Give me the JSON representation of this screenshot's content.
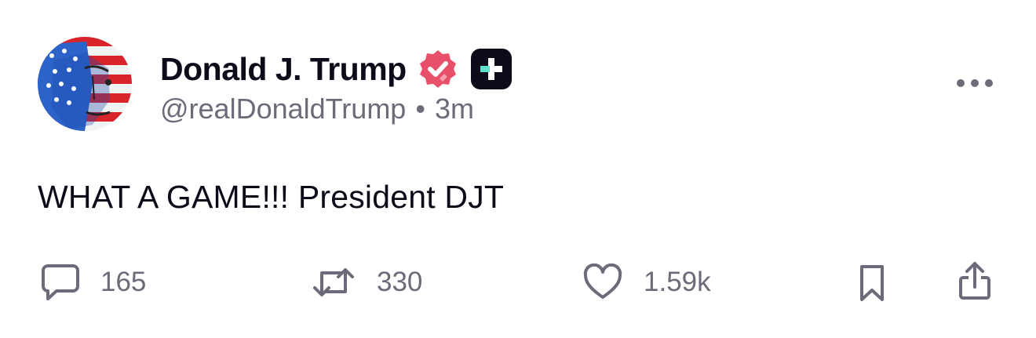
{
  "author": {
    "display_name": "Donald J. Trump",
    "handle": "@realDonaldTrump",
    "separator": "•",
    "timestamp": "3m",
    "verified_icon": "verified-badge-icon",
    "plus_icon": "plus-badge-icon",
    "avatar_icon": "avatar"
  },
  "post": {
    "text": "WHAT A GAME!!! President DJT"
  },
  "actions": {
    "replies": "165",
    "reposts": "330",
    "likes": "1.59k"
  },
  "colors": {
    "verified": "#e8506a",
    "text_primary": "#0b0b1a",
    "text_secondary": "#6b6b7a",
    "icon": "#6b6b7a"
  }
}
